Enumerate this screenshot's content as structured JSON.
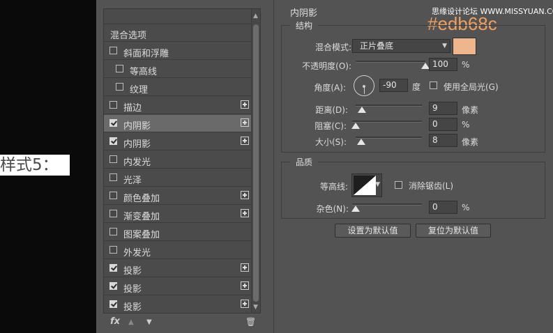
{
  "caption": "样式5：",
  "watermark": "思缘设计论坛 WWW.MISSYUAN.COM",
  "color_hex_label": "#edb68c",
  "left_panel": {
    "header_item": "混合选项",
    "items": [
      {
        "label": "斜面和浮雕",
        "checked": false,
        "plus": false,
        "indent": 0
      },
      {
        "label": "等高线",
        "checked": false,
        "plus": false,
        "indent": 1
      },
      {
        "label": "纹理",
        "checked": false,
        "plus": false,
        "indent": 1
      },
      {
        "label": "描边",
        "checked": false,
        "plus": true,
        "indent": 0
      },
      {
        "label": "内阴影",
        "checked": true,
        "plus": true,
        "indent": 0,
        "active": true
      },
      {
        "label": "内阴影",
        "checked": true,
        "plus": true,
        "indent": 0
      },
      {
        "label": "内发光",
        "checked": false,
        "plus": false,
        "indent": 0
      },
      {
        "label": "光泽",
        "checked": false,
        "plus": false,
        "indent": 0
      },
      {
        "label": "颜色叠加",
        "checked": false,
        "plus": true,
        "indent": 0
      },
      {
        "label": "渐变叠加",
        "checked": false,
        "plus": true,
        "indent": 0
      },
      {
        "label": "图案叠加",
        "checked": false,
        "plus": false,
        "indent": 0
      },
      {
        "label": "外发光",
        "checked": false,
        "plus": false,
        "indent": 0
      },
      {
        "label": "投影",
        "checked": true,
        "plus": true,
        "indent": 0
      },
      {
        "label": "投影",
        "checked": true,
        "plus": true,
        "indent": 0
      },
      {
        "label": "投影",
        "checked": true,
        "plus": true,
        "indent": 0
      }
    ],
    "bottom": {
      "fx": "fx",
      "up": "▲",
      "down": "▼",
      "trash": "🗑"
    }
  },
  "right_panel": {
    "section_title": "内阴影",
    "structure": {
      "title": "结构",
      "blend_mode_label": "混合模式:",
      "blend_mode_value": "正片叠底",
      "blend_color": "#edb68c",
      "opacity_label": "不透明度(O):",
      "opacity_value": "100",
      "opacity_unit": "%",
      "opacity_fraction": 1.0,
      "angle_label": "角度(A):",
      "angle_value": "-90",
      "angle_unit": "度",
      "global_light_label": "使用全局光(G)",
      "distance_label": "距离(D):",
      "distance_value": "9",
      "distance_unit": "像素",
      "distance_fraction": 0.09,
      "choke_label": "阻塞(C):",
      "choke_value": "0",
      "choke_unit": "%",
      "choke_fraction": 0.0,
      "size_label": "大小(S):",
      "size_value": "8",
      "size_unit": "像素",
      "size_fraction": 0.08
    },
    "quality": {
      "title": "品质",
      "contour_label": "等高线:",
      "antialias_label": "消除锯齿(L)",
      "noise_label": "杂色(N):",
      "noise_value": "0",
      "noise_unit": "%",
      "noise_fraction": 0.0
    },
    "buttons": {
      "make_default": "设置为默认值",
      "reset_default": "复位为默认值"
    }
  }
}
